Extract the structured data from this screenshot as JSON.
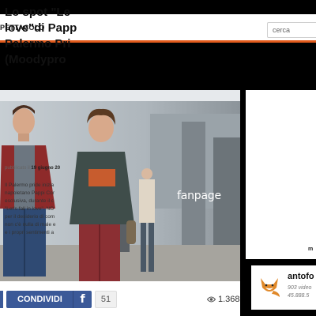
{
  "header": {
    "nav_title": "PETTACOLO",
    "search_placeholder": "cerca"
  },
  "video": {
    "logo": "fanpage"
  },
  "article": {
    "title_lines": [
      "Lo spot \"Le",
      "love\"di Papp",
      "Palermo Pri",
      "(Moodypro"
    ],
    "date_prefix": "pubblicato il",
    "date": "19 giugno 20",
    "body_lines": [
      "Il Palermo pride inizia",
      "napoletano Pappi Cor",
      "esclusiva, durante il c",
      "\"Let's fall in love\". NO",
      "per il desiderio di com",
      "non c'è nulla di male e",
      "e i propri sentimenti a"
    ],
    "more_label": "m"
  },
  "actions": {
    "share_label": "CONDIVIDI",
    "fb_icon_glyph": "f",
    "share_count": "51",
    "views": "1.368"
  },
  "author": {
    "name": "antofo",
    "stats_line1": "903 video",
    "stats_line2": "45.888.5"
  },
  "colors": {
    "accent": "#e25b1c",
    "facebook": "#3b5998"
  }
}
